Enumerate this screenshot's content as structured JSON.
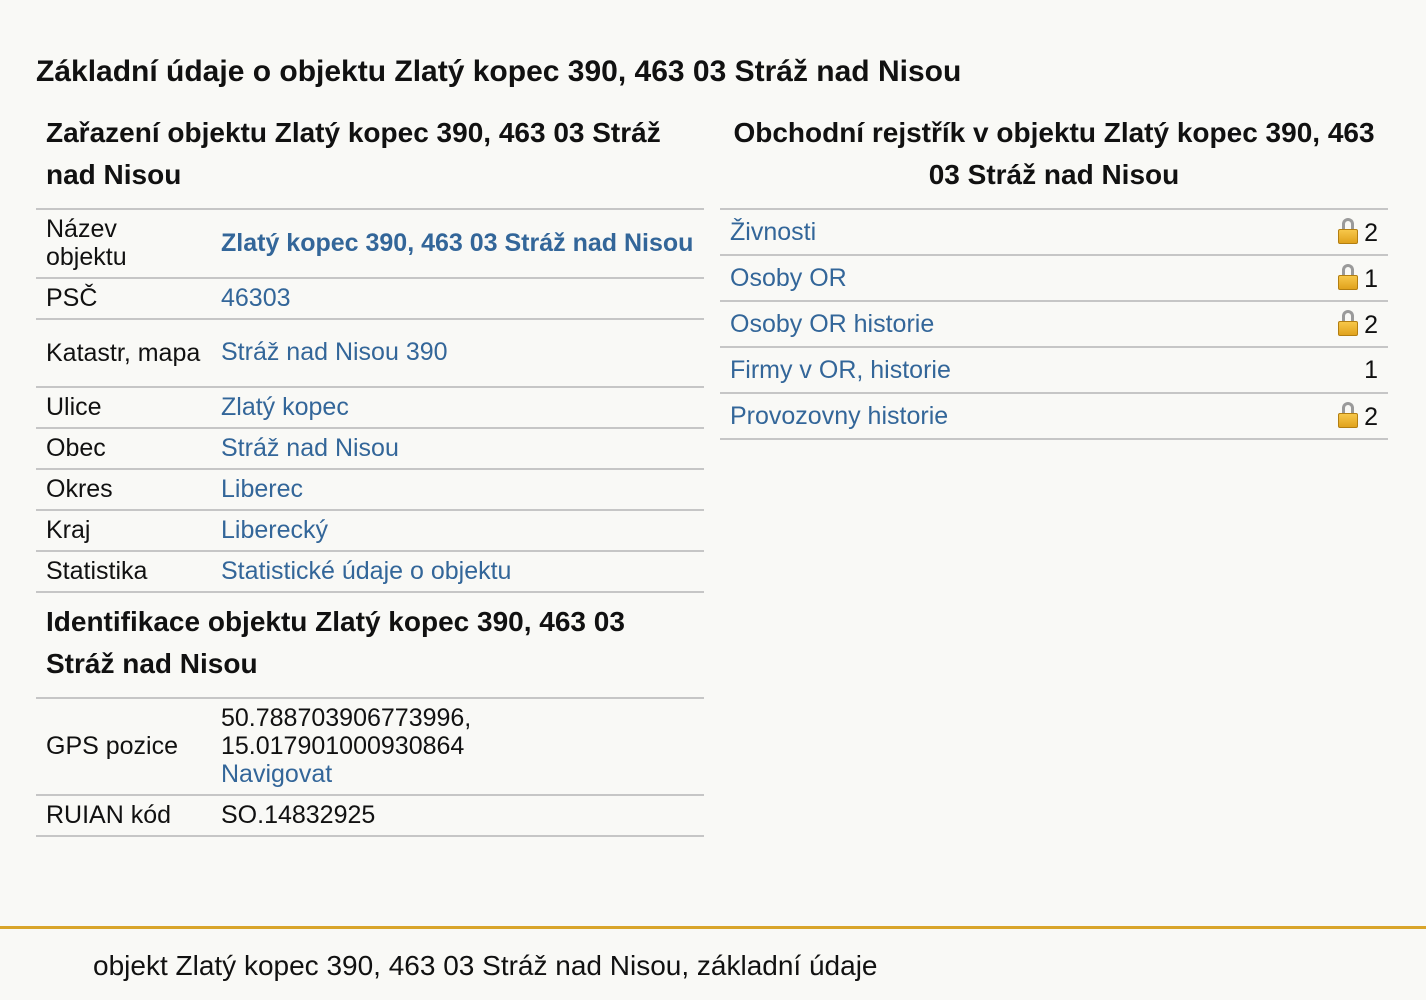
{
  "page": {
    "title": "Základní údaje o objektu Zlatý kopec 390, 463 03 Stráž nad Nisou"
  },
  "zarazeni": {
    "heading": "Zařazení objektu Zlatý kopec 390, 463 03 Stráž nad Nisou",
    "rows": [
      {
        "label": "Název objektu",
        "value": "Zlatý kopec 390, 463 03 Stráž nad Nisou"
      },
      {
        "label": "PSČ",
        "value": "46303"
      },
      {
        "label": "Katastr, mapa",
        "value": "Stráž nad Nisou 390"
      },
      {
        "label": "Ulice",
        "value": "Zlatý kopec"
      },
      {
        "label": "Obec",
        "value": "Stráž nad Nisou"
      },
      {
        "label": "Okres",
        "value": "Liberec"
      },
      {
        "label": "Kraj",
        "value": "Liberecký"
      },
      {
        "label": "Statistika",
        "value": "Statistické údaje o objektu"
      }
    ]
  },
  "identifikace": {
    "heading": "Identifikace objektu Zlatý kopec 390, 463 03 Stráž nad Nisou",
    "gps_label": "GPS pozice",
    "gps_lat": "50.788703906773996,",
    "gps_lon": "15.017901000930864",
    "navigate_label": "Navigovat",
    "ruian_label": "RUIAN kód",
    "ruian_value": "SO.14832925"
  },
  "rejstrik": {
    "heading": "Obchodní rejstřík v objektu Zlatý kopec 390, 463 03 Stráž nad Nisou",
    "rows": [
      {
        "label": "Živnosti",
        "count": "2",
        "locked": true
      },
      {
        "label": "Osoby OR",
        "count": "1",
        "locked": true
      },
      {
        "label": "Osoby OR historie",
        "count": "2",
        "locked": true
      },
      {
        "label": "Firmy v OR, historie",
        "count": "1",
        "locked": false
      },
      {
        "label": "Provozovny historie",
        "count": "2",
        "locked": true
      }
    ]
  },
  "footer": {
    "text": "objekt Zlatý kopec 390, 463 03 Stráž nad Nisou, základní údaje"
  },
  "colors": {
    "link": "#336699",
    "footer_line": "#d9a52b",
    "lock": "#e0a21c"
  }
}
